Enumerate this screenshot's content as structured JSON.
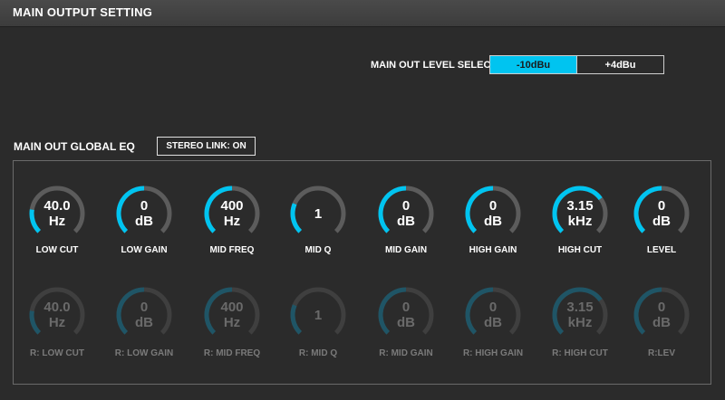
{
  "header": {
    "title": "MAIN OUTPUT SETTING"
  },
  "level_select": {
    "label": "MAIN OUT LEVEL SELECT",
    "options": [
      {
        "label": "-10dBu",
        "active": true
      },
      {
        "label": "+4dBu",
        "active": false
      }
    ]
  },
  "eq": {
    "title": "MAIN OUT GLOBAL EQ",
    "stereo_link": "STEREO LINK: ON",
    "row_left": [
      {
        "label": "LOW CUT",
        "line1": "40.0",
        "line2": "Hz",
        "level": 0.2
      },
      {
        "label": "LOW GAIN",
        "line1": "0",
        "line2": "dB",
        "level": 0.5
      },
      {
        "label": "MID FREQ",
        "line1": "400",
        "line2": "Hz",
        "level": 0.5
      },
      {
        "label": "MID Q",
        "line1": "1",
        "line2": "",
        "level": 0.25
      },
      {
        "label": "MID GAIN",
        "line1": "0",
        "line2": "dB",
        "level": 0.5
      },
      {
        "label": "HIGH GAIN",
        "line1": "0",
        "line2": "dB",
        "level": 0.5
      },
      {
        "label": "HIGH CUT",
        "line1": "3.15",
        "line2": "kHz",
        "level": 0.7
      },
      {
        "label": "LEVEL",
        "line1": "0",
        "line2": "dB",
        "level": 0.5
      }
    ],
    "row_right": [
      {
        "label": "R: LOW CUT",
        "line1": "40.0",
        "line2": "Hz",
        "level": 0.2
      },
      {
        "label": "R: LOW GAIN",
        "line1": "0",
        "line2": "dB",
        "level": 0.5
      },
      {
        "label": "R: MID FREQ",
        "line1": "400",
        "line2": "Hz",
        "level": 0.5
      },
      {
        "label": "R: MID Q",
        "line1": "1",
        "line2": "",
        "level": 0.25
      },
      {
        "label": "R: MID GAIN",
        "line1": "0",
        "line2": "dB",
        "level": 0.5
      },
      {
        "label": "R: HIGH GAIN",
        "line1": "0",
        "line2": "dB",
        "level": 0.5
      },
      {
        "label": "R: HIGH CUT",
        "line1": "3.15",
        "line2": "kHz",
        "level": 0.7
      },
      {
        "label": "R:LEV",
        "line1": "0",
        "line2": "dB",
        "level": 0.5
      }
    ]
  },
  "colors": {
    "accent": "#00c4f0",
    "accent_dim": "#1f5566",
    "track": "#5c5c5c",
    "track_dim": "#3f3f3f"
  }
}
